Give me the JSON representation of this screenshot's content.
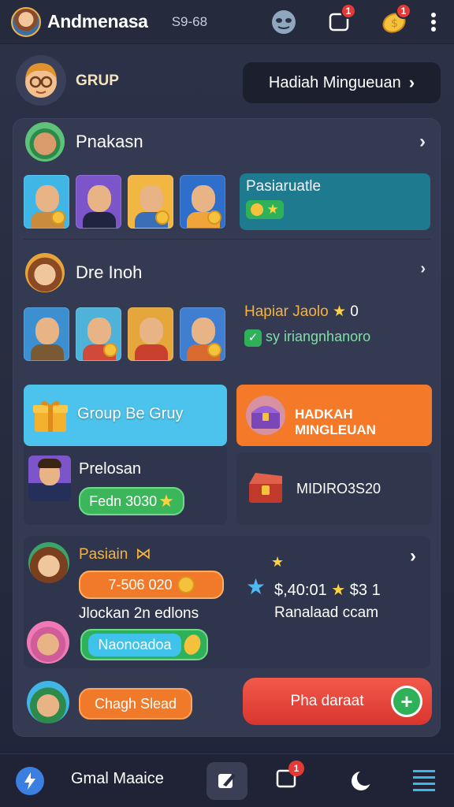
{
  "header": {
    "title": "Andmenasa",
    "subtitle": "S9-68",
    "icons": [
      "mask-icon",
      "notification-icon",
      "coin-icon",
      "more-icon"
    ],
    "notification_badge": "1",
    "coin_badge": "1"
  },
  "group": {
    "label": "GRUP",
    "weekly_button": "Hadiah Mingueuan",
    "weekly_chevron": "›"
  },
  "sections": [
    {
      "title": "Pnakasn",
      "chevron": "›",
      "info_title": "Pasiaruatle",
      "info_icons": [
        "coin-icon",
        "star-icon"
      ]
    },
    {
      "title": "Dre Inoh",
      "chevron": "›",
      "info_title": "Hapiar Jaolo",
      "info_value": "0",
      "info_sub": "sy iriangnhanoro"
    }
  ],
  "tiles": {
    "group_bonus": "Group Be Gruy",
    "weekly_reward": "HADKAH MINGLEUAN",
    "person_name": "Prelosan",
    "person_button": "Fedn 3030",
    "chest_label": "MIDIRO3S20"
  },
  "bottom_panel": {
    "title": "Pasiain",
    "coins_pill": "7-506 020",
    "caption": "Jlockan 2n edlons",
    "name_pill": "Naonoadoa",
    "stats_text": "$,40:01",
    "stats_value": "$3 1",
    "stats_caption": "Ranalaad ccam",
    "chevron": "›",
    "change_button": "Chagh Slead",
    "action_button": "Pha daraat",
    "action_icon": "+"
  },
  "bottom_nav": {
    "label": "Gmal Maaice",
    "nav_badge": "1",
    "icons": [
      "lightning-icon",
      "edit-icon",
      "notification-icon",
      "moon-icon",
      "menu-icon"
    ]
  },
  "colors": {
    "background": "#2a2f44",
    "panel": "#343a52",
    "accent_blue": "#3fb6e6",
    "accent_orange": "#f47a2a",
    "accent_green": "#3cb65a",
    "accent_red": "#ea3b3b",
    "badge": "#e53935",
    "gold": "#f6c23e"
  }
}
